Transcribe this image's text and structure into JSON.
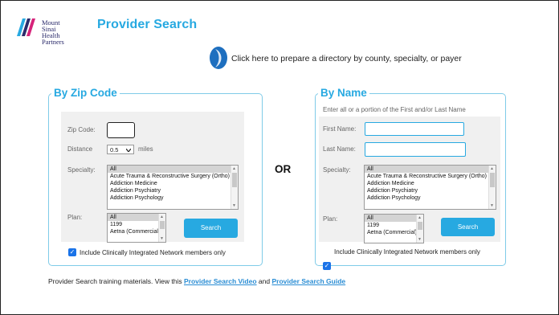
{
  "logo": {
    "lines": [
      "Mount",
      "Sinai",
      "Health",
      "Partners"
    ]
  },
  "page_title": "Provider Search",
  "directory_link": "Click here to prepare a directory by county, specialty, or payer",
  "or_label": "OR",
  "zip_section": {
    "legend": "By Zip Code",
    "zip_label": "Zip Code:",
    "zip_value": "",
    "distance_label": "Distance",
    "distance_value": "0.5",
    "miles_label": "miles",
    "specialty_label": "Specialty:",
    "specialty_options": [
      "All",
      "Acute Trauma & Reconstructive Surgery (Ortho)",
      "Addiction Medicine",
      "Addiction Psychiatry",
      "Addiction Psychology"
    ],
    "plan_label": "Plan:",
    "plan_options": [
      "All",
      "1199",
      "Aetna (Commercial) C"
    ],
    "search_label": "Search",
    "checkbox_label": "Include Clinically Integrated Network members only",
    "checkbox_checked": true
  },
  "name_section": {
    "legend": "By Name",
    "hint": "Enter all or a portion of the First and/or Last Name",
    "first_label": "First Name:",
    "first_value": "",
    "last_label": "Last Name:",
    "last_value": "",
    "specialty_label": "Specialty:",
    "specialty_options": [
      "All",
      "Acute Trauma & Reconstructive Surgery (Ortho)",
      "Addiction Medicine",
      "Addiction Psychiatry",
      "Addiction Psychology"
    ],
    "plan_label": "Plan:",
    "plan_options": [
      "All",
      "1199",
      "Aetna (Commercial) C"
    ],
    "search_label": "Search",
    "checkbox_label": "Include Clinically Integrated Network members only",
    "checkbox_checked": true
  },
  "footer": {
    "prefix": "Provider Search training materials.  View this",
    "video_link": "Provider Search Video",
    "and_text": "and",
    "guide_link": "Provider Search Guide"
  },
  "icons": {
    "checkbox": "checkmark-icon",
    "directory": "blue-circle-arrow-icon",
    "scroll_up": "triangle-up-icon",
    "scroll_down": "triangle-down-icon",
    "dropdown": "chevron-down-icon"
  },
  "colors": {
    "accent": "#27a9e1",
    "checkbox": "#1a73e8",
    "brand": "#2b2b6b"
  }
}
